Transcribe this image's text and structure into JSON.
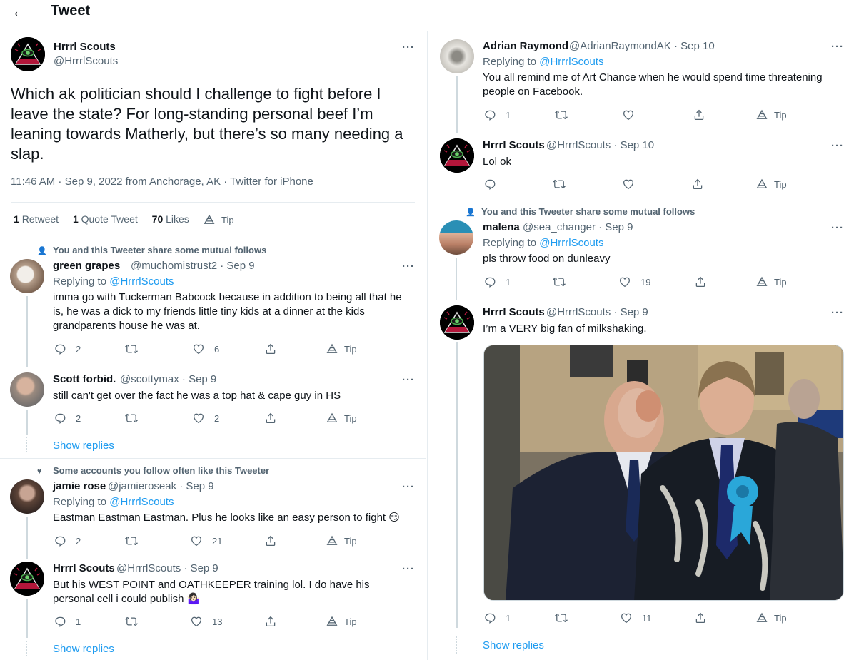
{
  "header": {
    "back_icon": "back-arrow-icon",
    "title": "Tweet"
  },
  "main": {
    "name": "Hrrrl Scouts",
    "handle": "@HrrrlScouts",
    "text": "Which ak politician should I challenge to fight before I leave the state? For long-standing personal beef I’m leaning towards Matherly, but there’s so many needing a slap.",
    "meta": "11:46 AM · Sep 9, 2022 from Anchorage, AK · Twitter for iPhone",
    "stats": {
      "retweets_count": "1",
      "retweets_label": "Retweet",
      "quotes_count": "1",
      "quotes_label": "Quote Tweet",
      "likes_count": "70",
      "likes_label": "Likes",
      "tip": "Tip"
    }
  },
  "left": {
    "social1": "You and this Tweeter share some mutual follows",
    "reply1": {
      "name": "green grapes",
      "handle": "@muchomistrust2 · Sep 9",
      "replying": "Replying to ",
      "replying_link": "@HrrrlScouts",
      "text": "imma go with Tuckerman Babcock because in addition to being all that he is, he was a dick to my friends little tiny kids at a dinner at the kids grandparents house he was at.",
      "replies": "2",
      "likes": "6",
      "tip": "Tip"
    },
    "reply2": {
      "name": "Scott forbid.",
      "handle": "@scottymax · Sep 9",
      "text": "still can't get over the fact he was a top hat & cape guy in HS",
      "replies": "2",
      "likes": "2",
      "tip": "Tip"
    },
    "show_replies_1": "Show replies",
    "social2": "Some accounts you follow often like this Tweeter",
    "reply3": {
      "name": "jamie rose",
      "handle": "@jamieroseak · Sep 9",
      "replying": "Replying to ",
      "replying_link": "@HrrrlScouts",
      "text": "Eastman Eastman Eastman. Plus he looks like an easy person to fight 😏",
      "replies": "2",
      "likes": "21",
      "tip": "Tip"
    },
    "reply4": {
      "name": "Hrrrl Scouts",
      "handle": "@HrrrlScouts · Sep 9",
      "text": "But his WEST POINT and OATHKEEPER training lol. I do have his personal cell i could publish 🤷🏻‍♀️",
      "replies": "1",
      "likes": "13",
      "tip": "Tip"
    },
    "show_replies_2": "Show replies"
  },
  "right": {
    "reply1": {
      "name": "Adrian Raymond",
      "handle": "@AdrianRaymondAK · Sep 10",
      "replying": "Replying to ",
      "replying_link": "@HrrrlScouts",
      "text": "You all remind me of Art Chance when he would spend time threatening people on Facebook.",
      "replies": "1",
      "likes": "",
      "tip": "Tip"
    },
    "reply2": {
      "name": "Hrrrl Scouts",
      "handle": "@HrrrlScouts · Sep 10",
      "text": "Lol ok",
      "replies": "",
      "likes": "",
      "tip": "Tip"
    },
    "social1": "You and this Tweeter share some mutual follows",
    "reply3": {
      "name": "malena",
      "handle": "@sea_changer · Sep 9",
      "replying": "Replying to ",
      "replying_link": "@HrrrlScouts",
      "text": "pls throw food on dunleavy",
      "replies": "1",
      "likes": "19",
      "tip": "Tip"
    },
    "reply4": {
      "name": "Hrrrl Scouts",
      "handle": "@HrrrlScouts · Sep 9",
      "text": "I’m a VERY big fan of milkshaking.",
      "replies": "1",
      "likes": "11",
      "tip": "Tip",
      "media_alt": "Photo of two men in suits on a street, one splattered with milkshake"
    },
    "show_replies": "Show replies"
  },
  "more_icon": "···",
  "colors": {
    "link": "#1d9bf0",
    "text": "#0f1419",
    "secondary": "#536471",
    "divider": "#e6ecf0"
  }
}
